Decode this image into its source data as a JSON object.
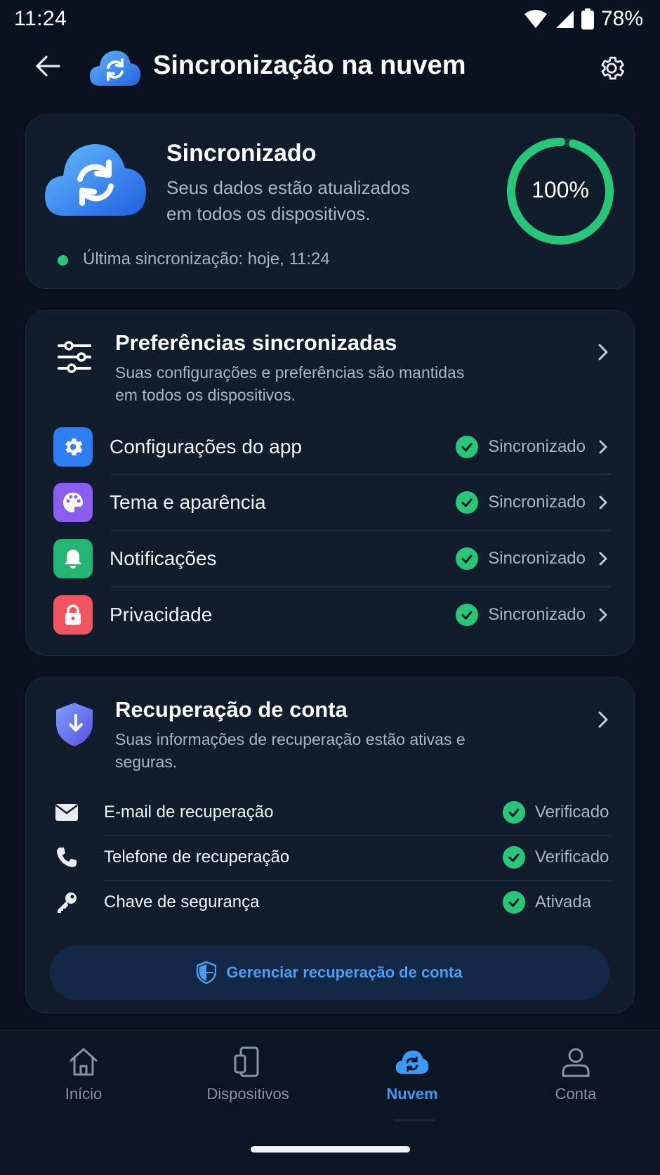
{
  "status_bar": {
    "time": "11:24",
    "battery": "78%"
  },
  "header": {
    "title": "Sincronização na nuvem",
    "back_icon": "arrow-left-icon",
    "settings_icon": "gear-icon"
  },
  "sync_card": {
    "title": "Sincronizado",
    "description": "Seus dados estão atualizados em todos os dispositivos.",
    "progress_percent": 100,
    "progress_label": "100%",
    "last_sync": "Última sincronização: hoje, 11:24",
    "status_color": "#27c77a"
  },
  "prefs": {
    "title": "Preferências sincronizadas",
    "description": "Suas configurações e preferências são mantidas em todos os dispositivos.",
    "items": [
      {
        "label": "Configurações do app",
        "status": "Sincronizado",
        "icon": "gear-icon",
        "color": "#2f7df0"
      },
      {
        "label": "Tema e aparência",
        "status": "Sincronizado",
        "icon": "palette-icon",
        "color": "#8b5cf0"
      },
      {
        "label": "Notificações",
        "status": "Sincronizado",
        "icon": "bell-icon",
        "color": "#22b573"
      },
      {
        "label": "Privacidade",
        "status": "Sincronizado",
        "icon": "lock-icon",
        "color": "#f0555f"
      }
    ]
  },
  "recovery": {
    "title": "Recuperação de conta",
    "description": "Suas informações de recuperação estão ativas e seguras.",
    "items": [
      {
        "label": "E-mail de recuperação",
        "status": "Verificado",
        "icon": "envelope-icon"
      },
      {
        "label": "Telefone de recuperação",
        "status": "Verificado",
        "icon": "phone-icon"
      },
      {
        "label": "Chave de segurança",
        "status": "Ativada",
        "icon": "key-icon"
      }
    ],
    "manage_button": "Gerenciar recuperação de conta"
  },
  "bottom_nav": {
    "items": [
      {
        "label": "Início",
        "icon": "home-icon",
        "active": false
      },
      {
        "label": "Dispositivos",
        "icon": "devices-icon",
        "active": false
      },
      {
        "label": "Nuvem",
        "icon": "cloud-sync-icon",
        "active": true
      },
      {
        "label": "Conta",
        "icon": "person-icon",
        "active": false
      }
    ]
  },
  "colors": {
    "accent": "#3a9bf3",
    "success": "#27c77a",
    "background": "#0a1220",
    "card": "#111c2d"
  }
}
